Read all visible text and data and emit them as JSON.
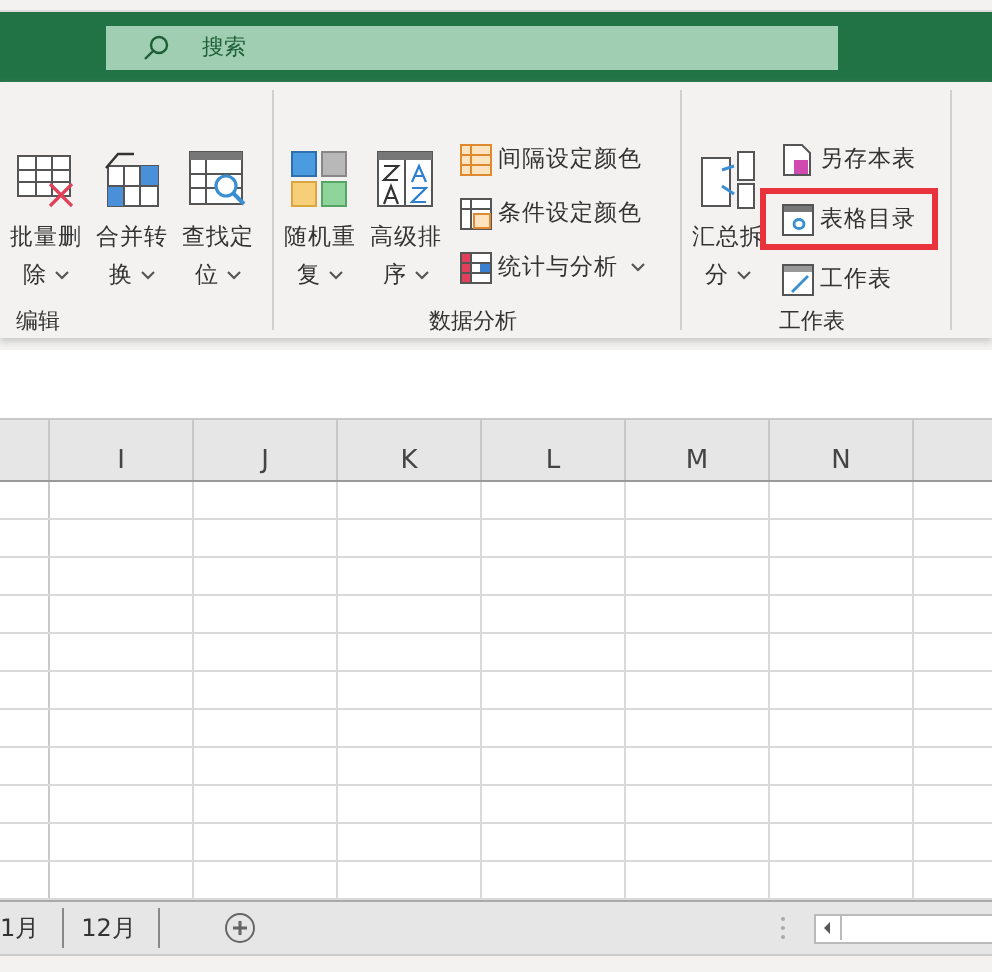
{
  "search": {
    "placeholder": "搜索"
  },
  "ribbon": {
    "groups": [
      {
        "label": "编辑",
        "items": [
          {
            "kind": "large",
            "lines": [
              "批量删",
              "除"
            ],
            "dropdown": true
          },
          {
            "kind": "large",
            "lines": [
              "合并转",
              "换"
            ],
            "dropdown": true
          },
          {
            "kind": "large",
            "lines": [
              "查找定",
              "位"
            ],
            "dropdown": true
          }
        ]
      },
      {
        "label": "数据分析",
        "items": [
          {
            "kind": "large",
            "lines": [
              "随机重",
              "复"
            ],
            "dropdown": true
          },
          {
            "kind": "large",
            "lines": [
              "高级排",
              "序"
            ],
            "dropdown": true
          },
          {
            "kind": "small",
            "rows": [
              {
                "label": "间隔设定颜色",
                "dropdown": false,
                "highlighted": false
              },
              {
                "label": "条件设定颜色",
                "dropdown": false,
                "highlighted": false
              },
              {
                "label": "统计与分析",
                "dropdown": true,
                "highlighted": false
              }
            ]
          }
        ]
      },
      {
        "label": "工作表",
        "items": [
          {
            "kind": "large",
            "lines": [
              "汇总拆",
              "分"
            ],
            "dropdown": true
          },
          {
            "kind": "small",
            "rows": [
              {
                "label": "另存本表",
                "dropdown": false,
                "highlighted": false
              },
              {
                "label": "表格目录",
                "dropdown": false,
                "highlighted": true
              },
              {
                "label": "工作表",
                "dropdown": false,
                "highlighted": false
              }
            ]
          }
        ]
      }
    ]
  },
  "grid": {
    "columns": [
      "I",
      "J",
      "K",
      "L",
      "M",
      "N"
    ]
  },
  "sheet_tabs": [
    {
      "label": "1月",
      "selected": false
    },
    {
      "label": "12月",
      "selected": false
    }
  ]
}
